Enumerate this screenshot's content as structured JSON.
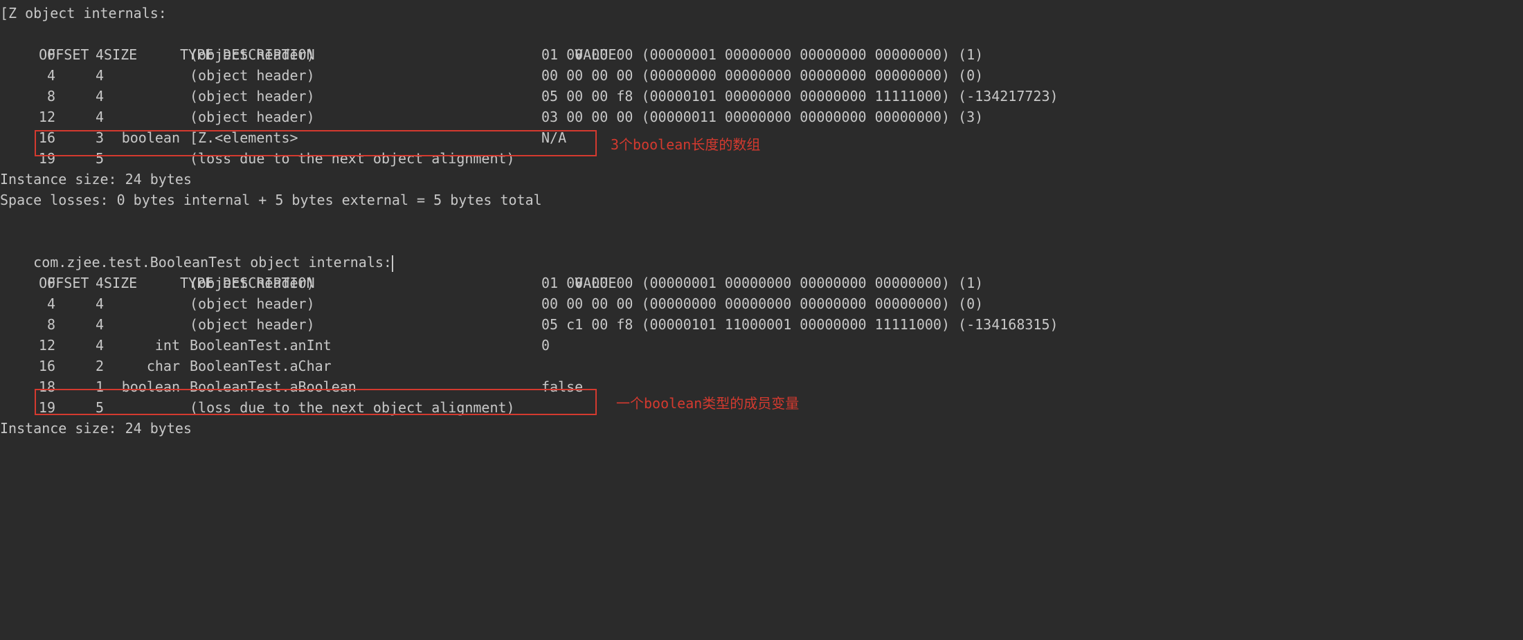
{
  "section1": {
    "title": "[Z object internals:",
    "headers": {
      "offset": "OFFSET",
      "size": "SIZE",
      "type": "TYPE",
      "desc": "DESCRIPTION",
      "value": "VALUE"
    },
    "rows": [
      {
        "offset": "0",
        "size": "4",
        "type": "",
        "desc": "(object header)",
        "value": "01 00 00 00 (00000001 00000000 00000000 00000000) (1)"
      },
      {
        "offset": "4",
        "size": "4",
        "type": "",
        "desc": "(object header)",
        "value": "00 00 00 00 (00000000 00000000 00000000 00000000) (0)"
      },
      {
        "offset": "8",
        "size": "4",
        "type": "",
        "desc": "(object header)",
        "value": "05 00 00 f8 (00000101 00000000 00000000 11111000) (-134217723)"
      },
      {
        "offset": "12",
        "size": "4",
        "type": "",
        "desc": "(object header)",
        "value": "03 00 00 00 (00000011 00000000 00000000 00000000) (3)"
      },
      {
        "offset": "16",
        "size": "3",
        "type": "boolean",
        "desc": "[Z.<elements>",
        "value": "N/A"
      },
      {
        "offset": "19",
        "size": "5",
        "type": "",
        "desc": "(loss due to the next object alignment)",
        "value": ""
      }
    ],
    "footer1": "Instance size: 24 bytes",
    "footer2": "Space losses: 0 bytes internal + 5 bytes external = 5 bytes total",
    "annotation": "3个boolean长度的数组"
  },
  "section2": {
    "title": "com.zjee.test.BooleanTest object internals:",
    "headers": {
      "offset": "OFFSET",
      "size": "SIZE",
      "type": "TYPE",
      "desc": "DESCRIPTION",
      "value": "VALUE"
    },
    "rows": [
      {
        "offset": "0",
        "size": "4",
        "type": "",
        "desc": "(object header)",
        "value": "01 00 00 00 (00000001 00000000 00000000 00000000) (1)"
      },
      {
        "offset": "4",
        "size": "4",
        "type": "",
        "desc": "(object header)",
        "value": "00 00 00 00 (00000000 00000000 00000000 00000000) (0)"
      },
      {
        "offset": "8",
        "size": "4",
        "type": "",
        "desc": "(object header)",
        "value": "05 c1 00 f8 (00000101 11000001 00000000 11111000) (-134168315)"
      },
      {
        "offset": "12",
        "size": "4",
        "type": "int",
        "desc": "BooleanTest.anInt",
        "value": "0"
      },
      {
        "offset": "16",
        "size": "2",
        "type": "char",
        "desc": "BooleanTest.aChar",
        "value": ""
      },
      {
        "offset": "18",
        "size": "1",
        "type": "boolean",
        "desc": "BooleanTest.aBoolean",
        "value": "false"
      },
      {
        "offset": "19",
        "size": "5",
        "type": "",
        "desc": "(loss due to the next object alignment)",
        "value": ""
      }
    ],
    "footer1": "Instance size: 24 bytes",
    "annotation": "一个boolean类型的成员变量"
  }
}
